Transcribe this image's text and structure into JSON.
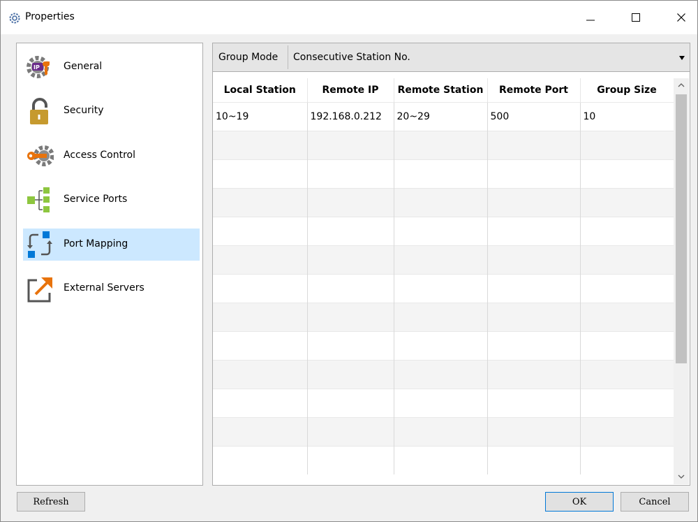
{
  "window": {
    "title": "Properties"
  },
  "sidebar": {
    "items": [
      {
        "label": "General",
        "icon": "gear-ip-icon",
        "selected": false
      },
      {
        "label": "Security",
        "icon": "padlock-icon",
        "selected": false
      },
      {
        "label": "Access Control",
        "icon": "key-gear-icon",
        "selected": false
      },
      {
        "label": "Service Ports",
        "icon": "tree-ports-icon",
        "selected": false
      },
      {
        "label": "Port Mapping",
        "icon": "port-mapping-icon",
        "selected": true
      },
      {
        "label": "External Servers",
        "icon": "external-link-icon",
        "selected": false
      }
    ]
  },
  "group_mode": {
    "label": "Group Mode",
    "value": "Consecutive Station No."
  },
  "table": {
    "headers": [
      "Local Station",
      "Remote IP",
      "Remote Station",
      "Remote Port",
      "Group Size"
    ],
    "rows": [
      [
        "10~19",
        "192.168.0.212",
        "20~29",
        "500",
        "10"
      ]
    ]
  },
  "buttons": {
    "refresh": "Refresh",
    "ok": "OK",
    "cancel": "Cancel"
  },
  "colors": {
    "selection": "#cce8ff",
    "orange": "#e8730c",
    "blue": "#0078d7",
    "green": "#8dc63f",
    "gold": "#c69a2e"
  }
}
